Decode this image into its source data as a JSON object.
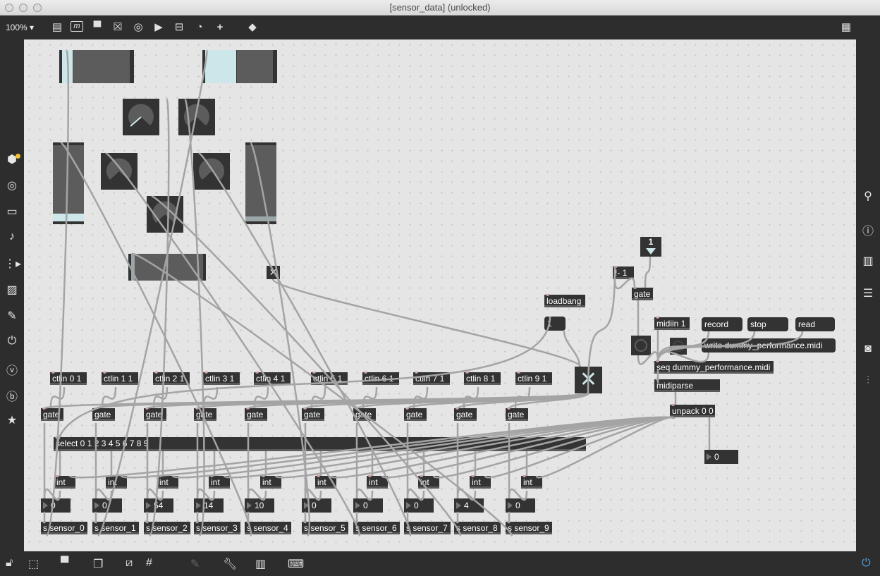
{
  "window": {
    "title": "[sensor_data] (unlocked)"
  },
  "toolbar": {
    "zoom": "100%",
    "icons": [
      "presentation-icon",
      "message-icon",
      "comment-icon",
      "toggle-icon",
      "button-icon",
      "number-icon",
      "slider-icon",
      "dial-icon",
      "add-icon",
      "paint-bucket-icon",
      "grid-icon"
    ]
  },
  "sidebar_left": [
    "object-browser-icon",
    "circle-icon",
    "slider-icon",
    "music-note-icon",
    "play-list-icon",
    "image-icon",
    "paperclip-icon",
    "plugin-icon",
    "vimeo-icon",
    "bpatcher-icon",
    "star-icon"
  ],
  "sidebar_right": [
    "search-icon",
    "info-icon",
    "book-icon",
    "list-icon",
    "snapshot-icon",
    "inspector-icon"
  ],
  "objects": {
    "const_one": "1",
    "not_minus": "!- 1",
    "gate_main": "gate",
    "loadbang": "loadbang",
    "msg_one": "1",
    "midiin": "midiin 1",
    "record": "record",
    "stop": "stop",
    "read": "read",
    "write": "write dummy_performance.midi",
    "seq": "seq dummy_performance.midi",
    "midiparse": "midiparse",
    "unpack": "unpack 0 0",
    "num_out": "0",
    "select": "select 0 1 2 3 4 5 6 7 8 9"
  },
  "channels": [
    {
      "ctlin": "ctlin 0 1",
      "gate": "gate",
      "int": "int",
      "value": "0",
      "send": "s sensor_0"
    },
    {
      "ctlin": "ctlin 1 1",
      "gate": "gate",
      "int": "int",
      "value": "0",
      "send": "s sensor_1"
    },
    {
      "ctlin": "ctlin 2 1",
      "gate": "gate",
      "int": "int",
      "value": "54",
      "send": "s sensor_2"
    },
    {
      "ctlin": "ctlin 3 1",
      "gate": "gate",
      "int": "int",
      "value": "14",
      "send": "s sensor_3"
    },
    {
      "ctlin": "ctlin 4 1",
      "gate": "gate",
      "int": "int",
      "value": "10",
      "send": "s sensor_4"
    },
    {
      "ctlin": "ctlin 5 1",
      "gate": "gate",
      "int": "int",
      "value": "0",
      "send": "s sensor_5"
    },
    {
      "ctlin": "ctlin 6 1",
      "gate": "gate",
      "int": "int",
      "value": "0",
      "send": "s sensor_6"
    },
    {
      "ctlin": "ctlin 7 1",
      "gate": "gate",
      "int": "int",
      "value": "0",
      "send": "s sensor_7"
    },
    {
      "ctlin": "ctlin 8 1",
      "gate": "gate",
      "int": "int",
      "value": "4",
      "send": "s sensor_8"
    },
    {
      "ctlin": "ctlin 9 1",
      "gate": "gate",
      "int": "int",
      "value": "0",
      "send": "s sensor_9"
    }
  ],
  "bottom": [
    "lock-icon",
    "select-icon",
    "presentation-icon",
    "layers-icon",
    "hide-icon",
    "grid-icon",
    "attach-icon",
    "wrench-icon",
    "piano-icon",
    "keyboard-icon",
    "power-icon"
  ],
  "colors": {
    "accent": "#cde6ea",
    "object": "#333333",
    "canvas": "#e5e5e5",
    "cord": "#a0a0a0"
  }
}
